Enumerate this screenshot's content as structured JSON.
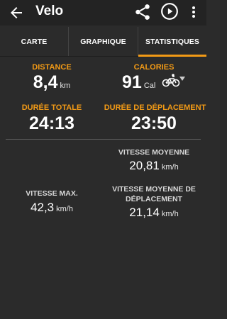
{
  "app": {
    "title": "Velo"
  },
  "tabs": [
    {
      "label": "CARTE"
    },
    {
      "label": "GRAPHIQUE"
    },
    {
      "label": "STATISTIQUES"
    }
  ],
  "stats": {
    "distance": {
      "label": "DISTANCE",
      "value": "8,4",
      "unit": "km"
    },
    "calories": {
      "label": "CALORIES",
      "value": "91",
      "unit": "Cal"
    },
    "total_duration": {
      "label": "DURÉE TOTALE",
      "value": "24:13"
    },
    "moving_duration": {
      "label": "DURÉE DE DÉPLACEMENT",
      "value": "23:50"
    },
    "avg_speed": {
      "label": "VITESSE MOYENNE",
      "value": "20,81",
      "unit": "km/h"
    },
    "max_speed": {
      "label": "VITESSE MAX.",
      "value": "42,3",
      "unit": "km/h"
    },
    "avg_moving_speed": {
      "label_line1": "VITESSE MOYENNE DE",
      "label_line2": "DÉPLACEMENT",
      "value": "21,14",
      "unit": "km/h"
    }
  },
  "colors": {
    "accent": "#f29a16",
    "background": "#2b2b2b",
    "topbar": "#232323"
  },
  "icons": [
    "back-arrow-icon",
    "share-icon",
    "play-icon",
    "more-vert-icon",
    "bike-icon",
    "dropdown-caret-icon"
  ]
}
